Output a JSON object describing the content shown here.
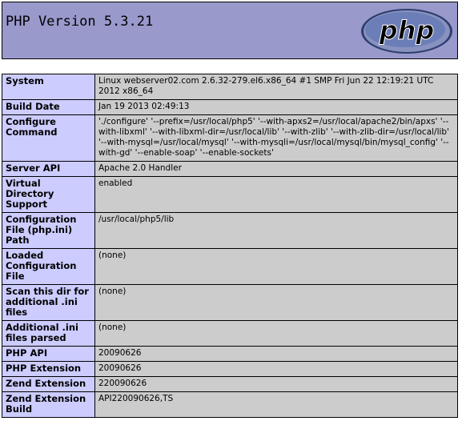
{
  "header": {
    "title": "PHP Version 5.3.21",
    "logo_text": "php"
  },
  "rows": [
    {
      "label": "System",
      "value": "Linux webserver02.com 2.6.32-279.el6.x86_64 #1 SMP Fri Jun 22 12:19:21 UTC 2012 x86_64"
    },
    {
      "label": "Build Date",
      "value": "Jan 19 2013 02:49:13"
    },
    {
      "label": "Configure Command",
      "value": "'./configure' '--prefix=/usr/local/php5' '--with-apxs2=/usr/local/apache2/bin/apxs' '--with-libxml' '--with-libxml-dir=/usr/local/lib' '--with-zlib' '--with-zlib-dir=/usr/local/lib' '--with-mysql=/usr/local/mysql' '--with-mysqli=/usr/local/mysql/bin/mysql_config' '--with-gd' '--enable-soap' '--enable-sockets'"
    },
    {
      "label": "Server API",
      "value": "Apache 2.0 Handler"
    },
    {
      "label": "Virtual Directory Support",
      "value": "enabled"
    },
    {
      "label": "Configuration File (php.ini) Path",
      "value": "/usr/local/php5/lib"
    },
    {
      "label": "Loaded Configuration File",
      "value": "(none)"
    },
    {
      "label": "Scan this dir for additional .ini files",
      "value": "(none)"
    },
    {
      "label": "Additional .ini files parsed",
      "value": "(none)"
    },
    {
      "label": "PHP API",
      "value": "20090626"
    },
    {
      "label": "PHP Extension",
      "value": "20090626"
    },
    {
      "label": "Zend Extension",
      "value": "220090626"
    },
    {
      "label": "Zend Extension Build",
      "value": "API220090626,TS"
    }
  ],
  "colors": {
    "header_bg": "#9999cc",
    "key_bg": "#ccccff",
    "value_bg": "#cccccc",
    "logo_fill": "#6c7eb7",
    "logo_dark": "#2f3e6e"
  }
}
